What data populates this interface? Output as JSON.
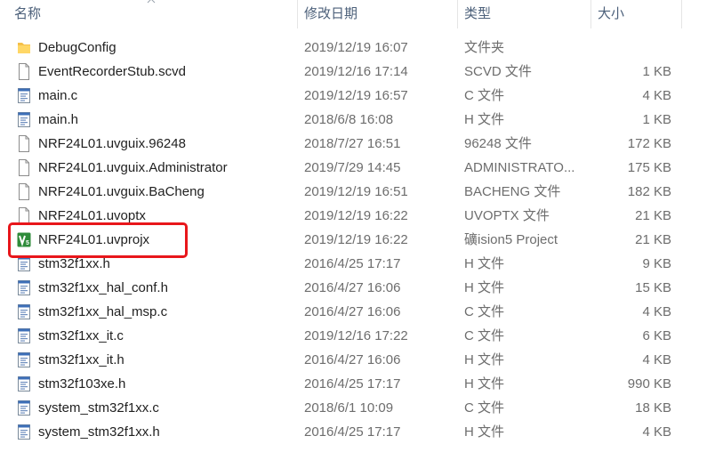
{
  "header": {
    "name": "名称",
    "date": "修改日期",
    "type": "类型",
    "size": "大小"
  },
  "files": [
    {
      "name": "DebugConfig",
      "date": "2019/12/19 16:07",
      "type": "文件夹",
      "size": "",
      "icon": "folder-icon"
    },
    {
      "name": "EventRecorderStub.scvd",
      "date": "2019/12/16 17:14",
      "type": "SCVD 文件",
      "size": "1 KB",
      "icon": "blank-file-icon"
    },
    {
      "name": "main.c",
      "date": "2019/12/19 16:57",
      "type": "C 文件",
      "size": "4 KB",
      "icon": "source-file-icon"
    },
    {
      "name": "main.h",
      "date": "2018/6/8 16:08",
      "type": "H 文件",
      "size": "1 KB",
      "icon": "source-file-icon"
    },
    {
      "name": "NRF24L01.uvguix.96248",
      "date": "2018/7/27 16:51",
      "type": "96248 文件",
      "size": "172 KB",
      "icon": "blank-file-icon"
    },
    {
      "name": "NRF24L01.uvguix.Administrator",
      "date": "2019/7/29 14:45",
      "type": "ADMINISTRATO...",
      "size": "175 KB",
      "icon": "blank-file-icon"
    },
    {
      "name": "NRF24L01.uvguix.BaCheng",
      "date": "2019/12/19 16:51",
      "type": "BACHENG 文件",
      "size": "182 KB",
      "icon": "blank-file-icon"
    },
    {
      "name": "NRF24L01.uvoptx",
      "date": "2019/12/19 16:22",
      "type": "UVOPTX 文件",
      "size": "21 KB",
      "icon": "blank-file-icon"
    },
    {
      "name": "NRF24L01.uvprojx",
      "date": "2019/12/19 16:22",
      "type": "礦ision5 Project",
      "size": "21 KB",
      "icon": "keil-project-icon"
    },
    {
      "name": "stm32f1xx.h",
      "date": "2016/4/25 17:17",
      "type": "H 文件",
      "size": "9 KB",
      "icon": "source-file-icon"
    },
    {
      "name": "stm32f1xx_hal_conf.h",
      "date": "2016/4/27 16:06",
      "type": "H 文件",
      "size": "15 KB",
      "icon": "source-file-icon"
    },
    {
      "name": "stm32f1xx_hal_msp.c",
      "date": "2016/4/27 16:06",
      "type": "C 文件",
      "size": "4 KB",
      "icon": "source-file-icon"
    },
    {
      "name": "stm32f1xx_it.c",
      "date": "2019/12/16 17:22",
      "type": "C 文件",
      "size": "6 KB",
      "icon": "source-file-icon"
    },
    {
      "name": "stm32f1xx_it.h",
      "date": "2016/4/27 16:06",
      "type": "H 文件",
      "size": "4 KB",
      "icon": "source-file-icon"
    },
    {
      "name": "stm32f103xe.h",
      "date": "2016/4/25 17:17",
      "type": "H 文件",
      "size": "990 KB",
      "icon": "source-file-icon"
    },
    {
      "name": "system_stm32f1xx.c",
      "date": "2018/6/1 10:09",
      "type": "C 文件",
      "size": "18 KB",
      "icon": "source-file-icon"
    },
    {
      "name": "system_stm32f1xx.h",
      "date": "2016/4/25 17:17",
      "type": "H 文件",
      "size": "4 KB",
      "icon": "source-file-icon"
    }
  ],
  "highlight": {
    "target": "NRF24L01.uvprojx",
    "color": "#e8161b"
  },
  "colors": {
    "header_text": "#4c607a",
    "meta_text": "#6d6d6d",
    "folder": "#f5c04a",
    "keil_green": "#2e8b3a"
  }
}
